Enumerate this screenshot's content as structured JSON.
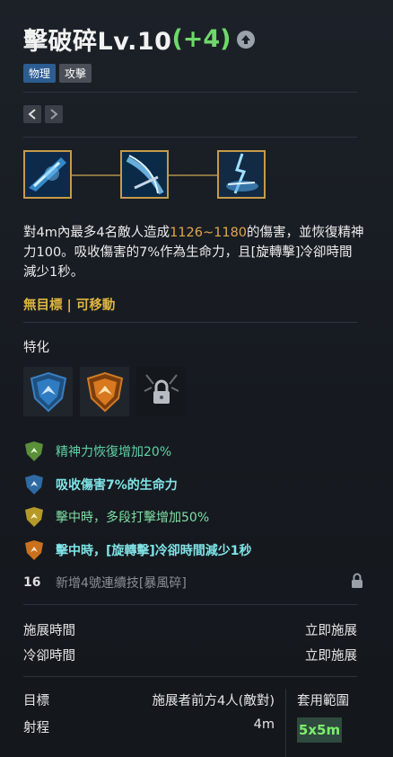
{
  "skill": {
    "name": "擊破碎Lv.10",
    "bonus": "(+4)",
    "tags": [
      "物理",
      "攻擊"
    ]
  },
  "description": {
    "part1": "對4m內最多4名敵人造成",
    "damage": "1126~1180",
    "part2": "的傷害，並恢復精神力100。吸收傷害的7%作為生命力，且[旋轉擊]冷卻時間減少1秒。"
  },
  "targeting": "無目標 | 可移動",
  "specialization": {
    "title": "特化",
    "items": [
      {
        "text": "精神力恢復增加20%",
        "icon": "green-shield-icon"
      },
      {
        "text": "吸收傷害7%的生命力",
        "icon": "blue-shield-icon"
      },
      {
        "text": "擊中時，多段打擊增加50%",
        "icon": "yellow-shield-icon"
      },
      {
        "text": "擊中時，[旋轉擊]冷卻時間減少1秒",
        "icon": "orange-shield-icon"
      }
    ],
    "locked": {
      "level": "16",
      "text": "新增4號連續技[暴風碎]"
    }
  },
  "timing": {
    "cast_label": "施展時間",
    "cast_value": "立即施展",
    "cooldown_label": "冷卻時間",
    "cooldown_value": "立即施展"
  },
  "stats": {
    "target_label": "目標",
    "target_value": "施展者前方4人(敵對)",
    "range_label": "射程",
    "range_value": "4m",
    "area_label": "套用範圍",
    "area_value": "5x5m"
  },
  "colors": {
    "bonus": "#6fd86a",
    "damage": "#e0a84a",
    "targeting": "#e0b640",
    "spec_text": "#7fe3e6"
  }
}
